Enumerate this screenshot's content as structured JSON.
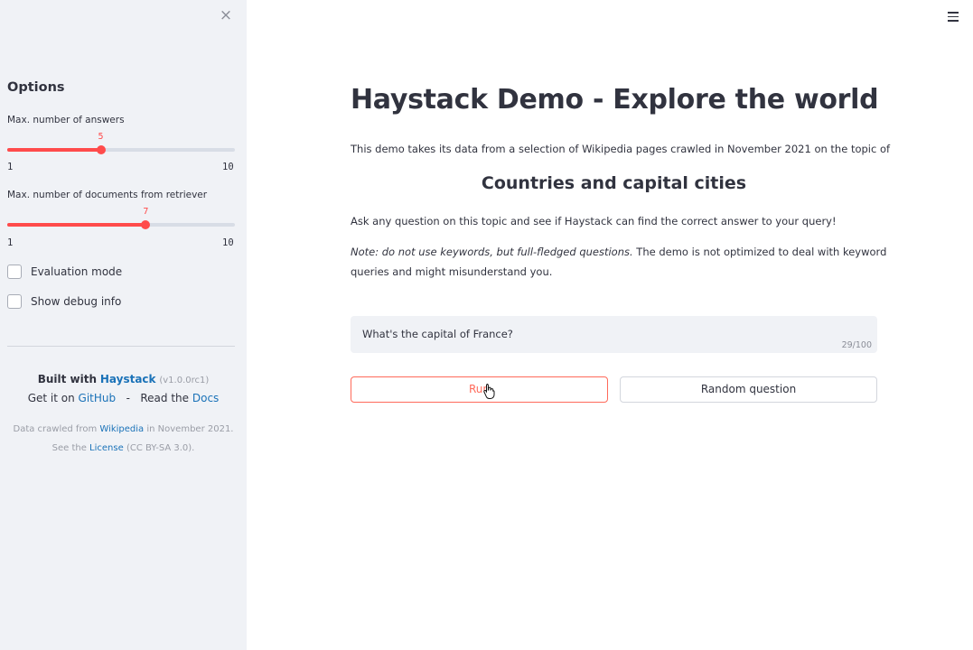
{
  "sidebar": {
    "close_icon": "×",
    "options_title": "Options",
    "slider1": {
      "label": "Max. number of answers",
      "value": 5,
      "min": 1,
      "max": 10,
      "value_text": "5",
      "min_text": "1",
      "max_text": "10"
    },
    "slider2": {
      "label": "Max. number of documents from retriever",
      "value": 7,
      "min": 1,
      "max": 10,
      "value_text": "7",
      "min_text": "1",
      "max_text": "10"
    },
    "eval_mode_label": "Evaluation mode",
    "debug_label": "Show debug info",
    "built_with": "Built with",
    "haystack_link": "Haystack",
    "version": "(v1.0.0rc1)",
    "get_it_on": "Get it on",
    "github_link": "GitHub",
    "dash": "-",
    "read_the": "Read the",
    "docs_link": "Docs",
    "crawled_prefix": "Data crawled from",
    "wikipedia_link": "Wikipedia",
    "crawled_suffix": "in November 2021.",
    "see_the": "See the",
    "license_link": "License",
    "license_suffix": "(CC BY-SA 3.0)."
  },
  "main": {
    "title": "Haystack Demo - Explore the world",
    "intro": "This demo takes its data from a selection of Wikipedia pages crawled in November 2021 on the topic of",
    "subtitle": "Countries and capital cities",
    "ask": "Ask any question on this topic and see if Haystack can find the correct answer to your query!",
    "note_italic": "Note: do not use keywords, but full-fledged questions.",
    "note_rest": " The demo is not optimized to deal with keyword",
    "note_line2": "queries and might misunderstand you.",
    "question_value": "What's the capital of France?",
    "char_count": "29/100",
    "run_label": "Run",
    "random_label": "Random question"
  },
  "colors": {
    "accent": "#ff4b4b",
    "link": "#1a72b8",
    "sidebar_bg": "#f0f2f6"
  }
}
